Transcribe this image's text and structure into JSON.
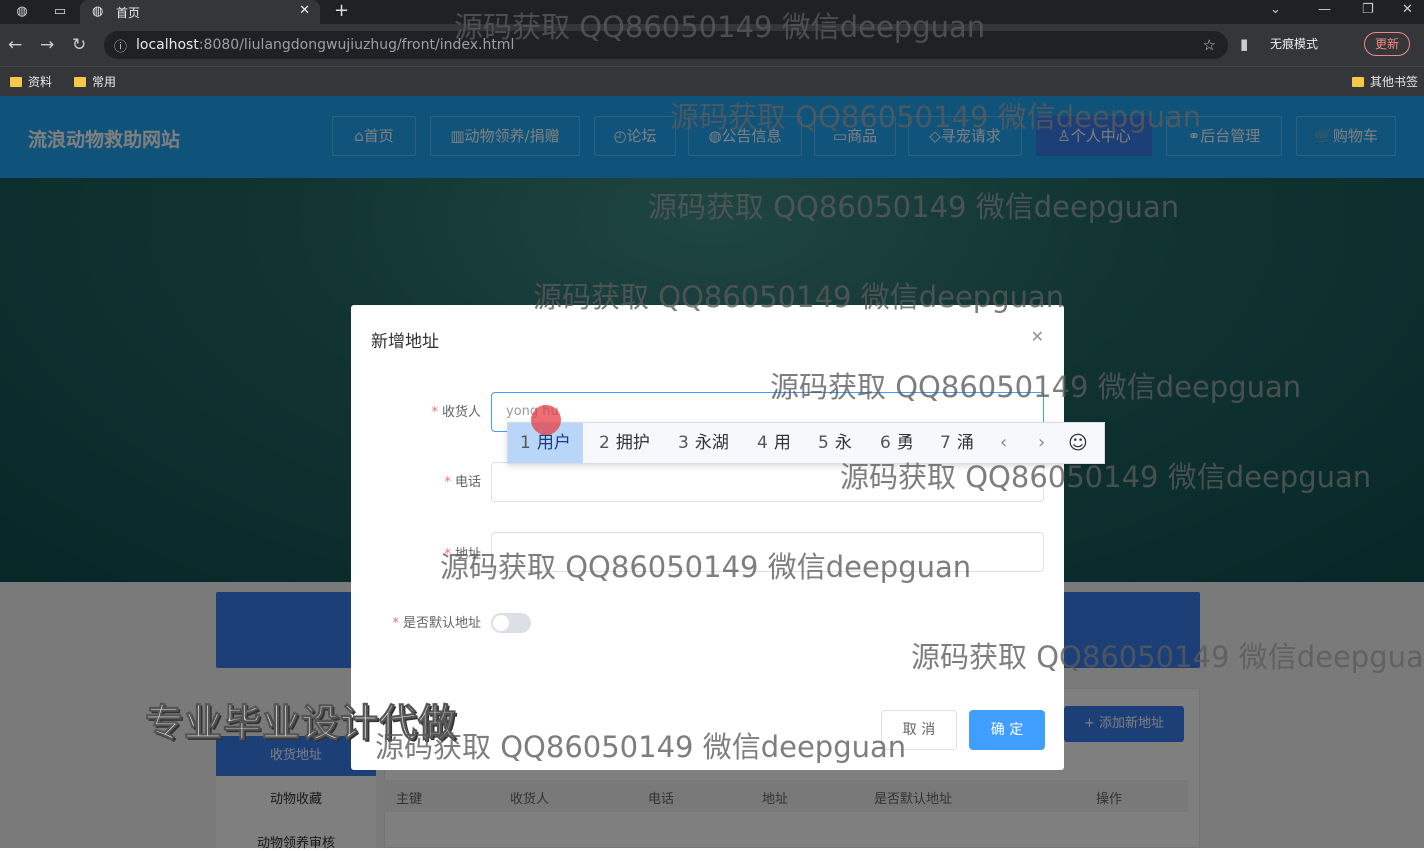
{
  "browser": {
    "tab_title": "首页",
    "url_host": "localhost",
    "url_rest": ":8080/liulangdongwujiuzhug/front/index.html",
    "incognito_label": "无痕模式",
    "update_label": "更新",
    "bookmarks": [
      "资料",
      "常用"
    ],
    "other_bookmarks": "其他书签"
  },
  "site": {
    "title": "流浪动物救助网站",
    "nav": [
      {
        "label": "⌂首页"
      },
      {
        "label": "▥动物领养/捐赠"
      },
      {
        "label": "◴论坛"
      },
      {
        "label": "◍公告信息"
      },
      {
        "label": "▭商品"
      },
      {
        "label": "◇寻宠请求"
      },
      {
        "label": "♙个人中心"
      },
      {
        "label": "⚭后台管理"
      },
      {
        "label": "🛒购物车"
      }
    ]
  },
  "dialog": {
    "title": "新增地址",
    "fields": {
      "receiver_label": "收货人",
      "receiver_value": "yong hu",
      "phone_label": "电话",
      "address_label": "地址",
      "default_label": "是否默认地址"
    },
    "cancel_label": "取 消",
    "ok_label": "确 定"
  },
  "ime": {
    "candidates": [
      {
        "num": "1",
        "text": "用户"
      },
      {
        "num": "2",
        "text": "拥护"
      },
      {
        "num": "3",
        "text": "永湖"
      },
      {
        "num": "4",
        "text": "用"
      },
      {
        "num": "5",
        "text": "永"
      },
      {
        "num": "6",
        "text": "勇"
      },
      {
        "num": "7",
        "text": "涌"
      }
    ]
  },
  "page": {
    "side_menu": [
      "收货地址",
      "动物收藏",
      "动物领养审核"
    ],
    "add_address_label": "+ 添加新地址",
    "table_headers": [
      "主键",
      "收货人",
      "电话",
      "地址",
      "是否默认地址",
      "操作"
    ]
  },
  "watermarks": {
    "text": "源码获取 QQ86050149 微信deepguan",
    "text_cut": "源码获取 QQ86050149 微信deepgua",
    "stamp": "专业毕业设计代做"
  }
}
